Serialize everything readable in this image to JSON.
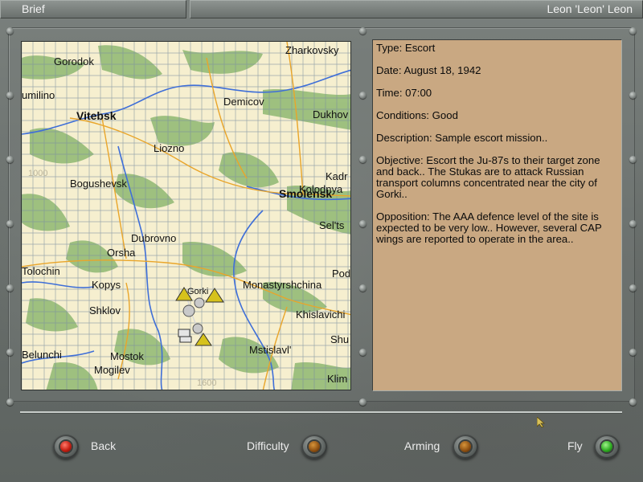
{
  "header": {
    "screen_title": "Brief",
    "pilot_name": "Leon  'Leon' Leon"
  },
  "map": {
    "labels": [
      {
        "text": "Zharkovsky",
        "style": "normal"
      },
      {
        "text": "Gorodok",
        "style": "normal"
      },
      {
        "text": "umilino",
        "style": "normal"
      },
      {
        "text": "Vitebsk",
        "style": "big"
      },
      {
        "text": "Demicov",
        "style": "normal"
      },
      {
        "text": "Dukhov",
        "style": "normal"
      },
      {
        "text": "Liozno",
        "style": "normal"
      },
      {
        "text": "Kadr",
        "style": "normal"
      },
      {
        "text": "Kolodnya",
        "style": "normal"
      },
      {
        "text": "Smolensk",
        "style": "big"
      },
      {
        "text": "Bogushevsk",
        "style": "normal"
      },
      {
        "text": "Sel'ts",
        "style": "normal"
      },
      {
        "text": "Dubrovno",
        "style": "normal"
      },
      {
        "text": "Orsha",
        "style": "normal"
      },
      {
        "text": "Tolochin",
        "style": "normal"
      },
      {
        "text": "Kopys",
        "style": "normal"
      },
      {
        "text": "Monastyrshchina",
        "style": "normal"
      },
      {
        "text": "Pod",
        "style": "normal"
      },
      {
        "text": "Shklov",
        "style": "normal"
      },
      {
        "text": "Khislavichi",
        "style": "normal"
      },
      {
        "text": "Shu",
        "style": "normal"
      },
      {
        "text": "Belunchi",
        "style": "normal"
      },
      {
        "text": "Mostok",
        "style": "normal"
      },
      {
        "text": "Mstislavl'",
        "style": "normal"
      },
      {
        "text": "Mogilev",
        "style": "normal"
      },
      {
        "text": "Klim",
        "style": "normal"
      },
      {
        "text": "Gorki",
        "style": "normal"
      },
      {
        "text": "1000",
        "style": "faint"
      },
      {
        "text": "1600",
        "style": "faint"
      }
    ]
  },
  "brief": {
    "type": "Type: Escort",
    "date": "Date: August 18, 1942",
    "time": "Time: 07:00",
    "conditions": "Conditions: Good",
    "description": "Description: Sample escort mission..",
    "objective": "Objective: Escort the Ju-87s to their target zone and back.. The Stukas are to attack Russian transport columns concentrated near the city of Gorki..",
    "opposition": "Opposition: The AAA defence level of the site is expected to be very low.. However, several CAP wings are reported to operate in the area.."
  },
  "buttons": {
    "back": "Back",
    "difficulty": "Difficulty",
    "arming": "Arming",
    "fly": "Fly"
  },
  "colors": {
    "map_land": "#f6efcf",
    "forest": "#8fb872",
    "river": "#3f6fd8",
    "road": "#e9a52a",
    "brief_bg": "#c9a882",
    "fly_light": "#2fae22",
    "back_light": "#c41f12"
  }
}
